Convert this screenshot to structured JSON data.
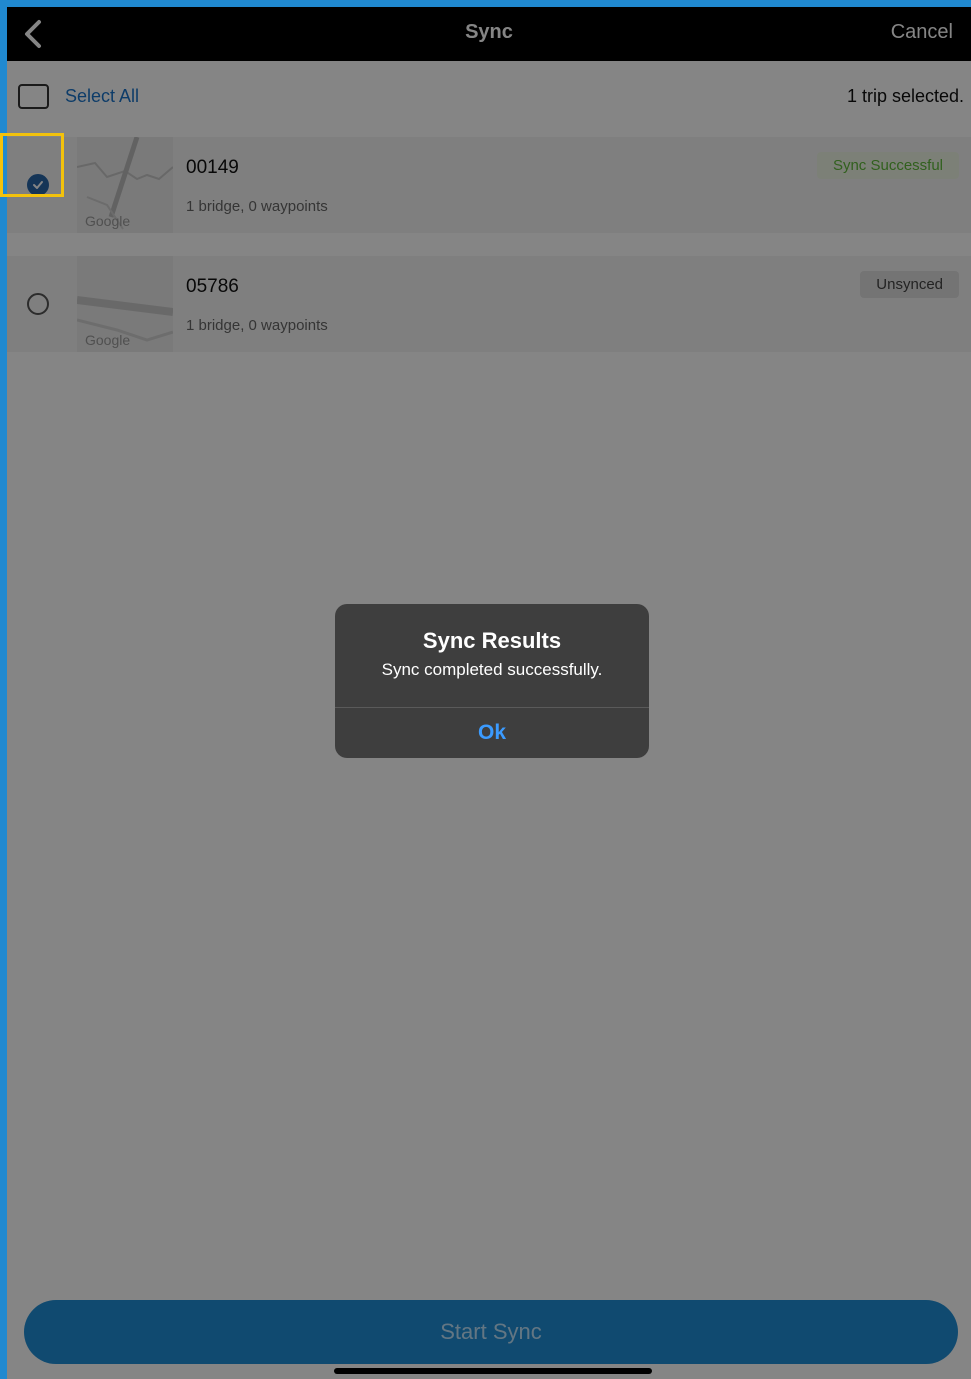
{
  "nav": {
    "title": "Sync",
    "cancel_label": "Cancel",
    "back_icon": "chevron-left-icon"
  },
  "selection": {
    "select_all_label": "Select All",
    "selected_count_text": "1 trip selected."
  },
  "trips": [
    {
      "id": "00149",
      "meta": "1 bridge, 0 waypoints",
      "status": "Sync Successful",
      "selected": true,
      "map_watermark": "Google"
    },
    {
      "id": "05786",
      "meta": "1 bridge, 0 waypoints",
      "status": "Unsynced",
      "selected": false,
      "map_watermark": "Google"
    }
  ],
  "footer": {
    "start_sync_label": "Start Sync"
  },
  "alert": {
    "title": "Sync Results",
    "message": "Sync completed successfully.",
    "ok_label": "Ok"
  },
  "colors": {
    "accent": "#1f8fd6",
    "link": "#1a73c9",
    "success": "#5fb83a",
    "highlight": "#f3c20c",
    "alert_button": "#3b9bff"
  }
}
